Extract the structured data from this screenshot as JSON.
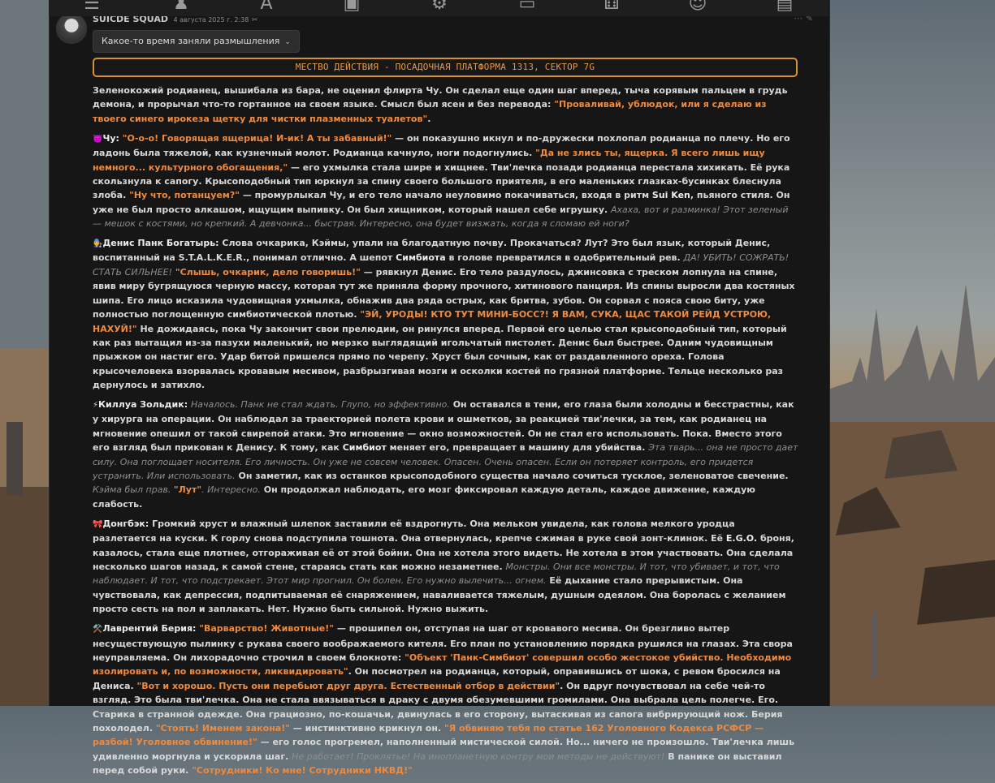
{
  "post": {
    "author": "SUICDE SQUAD",
    "date": "4 августа 2025 г. 2:38",
    "date_mark": "✂",
    "reflection_button": "Какое-то время заняли размышления",
    "location": "МЕСТВО ДЕЙСТВИЯ - ПОСАДОЧНАЯ ПЛАТФОРМА 1313, СЕКТОР 7G"
  },
  "toolbar": {
    "icons": [
      "sliders-icon",
      "brush-icon",
      "text-icon",
      "book-icon",
      "user-gear-icon",
      "image-icon",
      "dice-icon",
      "smile-icon",
      "id-card-icon"
    ]
  },
  "p1": [
    "Зеленокожий родианец, вышибала из бара, не оценил флирта Чу. Он сделал еще один шаг вперед, тыча корявым пальцем в грудь демона, и прорычал что-то гортанное на своем языке. Смысл был ясен и без перевода: ",
    "\"Проваливай, ублюдок, или я сделаю из твоего синего ирокеза щетку для чистки плазменных туалетов\"",
    "."
  ],
  "p2": {
    "emoji": "👿",
    "name": "Чу:",
    "parts": [
      "\"О-о-о! Говорящая ящерица! И-ик! А ты забавный!\"",
      " — он показушно икнул и по-дружески похлопал родианца по плечу. Но его ладонь была тяжелой, как кузнечный молот. Родианца качнуло, ноги подогнулись. ",
      "\"Да не злись ты, ящерка. Я всего лишь ищу немного... культурного обогащения,\"",
      " — его ухмылка стала шире и хищнее. Тви'лечка позади родианца перестала хихикать. Её рука скользнула к сапогу. Крысоподобный тип юркнул за спину своего большого приятеля, в его маленьких глазках-бусинках блеснула злоба. ",
      "\"Ну что, потанцуем?\"",
      " — промурлыкал Чу, и его тело начало неуловимо покачиваться, входя в ритм ",
      "Sui Ken",
      ", пьяного стиля. Он уже не был просто алкашом, ищущим выпивку. Он был хищником, который нашел себе игрушку. ",
      "Ахаха, вот и разминка! Этот зеленый — мешок с костями, но крепкий. А девчонка... быстрая. Интересно, она будет визжать, когда я сломаю ей ноги?"
    ]
  },
  "p3": {
    "emoji": "🧑‍🔧",
    "name": "Денис Панк Богатырь:",
    "parts": [
      " Слова очкарика, Кэймы, упали на благодатную почву. Прокачаться? Лут? Это был язык, который Денис, воспитанный на S.T.A.L.K.E.R., понимал отлично. А шепот ",
      "Симбиота",
      " в голове превратился в одобрительный рев. ",
      "ДА! УБИТЬ! СОЖРАТЬ! СТАТЬ СИЛЬНЕЕ!",
      " ",
      "\"Слышь, очкарик, дело говоришь!\"",
      " — рявкнул Денис. Его тело раздулось, джинсовка с треском лопнула на спине, явив миру бугрящуюся черную массу, которая тут же приняла форму прочного, хитинового панциря. Из спины выросли два костяных шипа. Его лицо исказила чудовищная ухмылка, обнажив два ряда острых, как бритва, зубов. Он сорвал с пояса свою биту, уже полностью поглощенную симбиотической плотью. ",
      "\"ЭЙ, УРОДЫ! КТО ТУТ МИНИ-БОСС?! Я ВАМ, СУКА, ЩАС ТАКОЙ РЕЙД УСТРОЮ, НАХУЙ!\"",
      " Не дожидаясь, пока Чу закончит свои прелюдии, он ринулся вперед. Первой его целью стал крысоподобный тип, который как раз вытащил из-за пазухи маленький, но мерзко выглядящий игольчатый пистолет. Денис был быстрее. Одним чудовищным прыжком он настиг его. Удар битой пришелся прямо по черепу. Хруст был сочным, как от раздавленного ореха. Голова крысочеловека взорвалась кровавым месивом, разбрызгивая мозги и осколки костей по грязной платформе. Тельце несколько раз дернулось и затихло."
    ]
  },
  "p4": {
    "emoji": "⚡",
    "name": "Киллуа Зольдик:",
    "parts": [
      " ",
      "Началось. Панк не стал ждать. Глупо, но эффективно.",
      " Он оставался в тени, его глаза были холодны и бесстрастны, как у хирурга на операции. Он наблюдал за траекторией полета крови и ошметков, за реакцией тви'лечки, за тем, как родианец на мгновение опешил от такой свирепой атаки. Это мгновение — окно возможностей. Он не стал его использовать. Пока. Вместо этого его взгляд был прикован к Денису. К тому, как ",
      "Симбиот",
      " меняет его, превращает в машину для убийства. ",
      "Эта тварь... она не просто дает силу. Она поглощает носителя. Его личность. Он уже не совсем человек. Опасен. Очень опасен. Если он потеряет контроль, его придется устранить. Или использовать.",
      " Он заметил, как из останков крысоподобного существа начало сочиться тусклое, зеленоватое свечение. ",
      "Кэйма был прав. ",
      "\"Лут\"",
      ". Интересно.",
      " Он продолжал наблюдать, его мозг фиксировал каждую деталь, каждое движение, каждую слабость."
    ]
  },
  "p5": {
    "emoji": "🎀",
    "name": "Донгбэк:",
    "parts": [
      " Громкий хруст и влажный шлепок заставили её вздрогнуть. Она мельком увидела, как голова мелкого уродца разлетается на куски. К горлу снова подступила тошнота. Она отвернулась, крепче сжимая в руке свой зонт-клинок. Её ",
      "E.G.O.",
      " броня, казалось, стала еще плотнее, отгораживая её от этой бойни. Она не хотела этого видеть. Не хотела в этом участвовать. Она сделала несколько шагов назад, к самой стене, стараясь стать как можно незаметнее. ",
      "Монстры. Они все монстры. И тот, что убивает, и тот, что наблюдает. И тот, что подстрекает. Этот мир прогнил. Он болен. Его нужно вылечить... огнем.",
      " Её дыхание стало прерывистым. Она чувствовала, как депрессия, подпитываемая её снаряжением, наваливается тяжелым, душным одеялом. Она боролась с желанием просто сесть на пол и заплакать. Нет. Нужно быть сильной. Нужно выжить."
    ]
  },
  "p6": {
    "emoji": "⚒️",
    "name": "Лаврентий Берия:",
    "parts": [
      " ",
      "\"Варварство! Животные!\"",
      " — прошипел он, отступая на шаг от кровавого месива. Он брезгливо вытер несуществующую пылинку с рукава своего воображаемого кителя. Его план по установлению порядка рушился на глазах. Эта свора неуправляема. Он лихорадочно строчил в своем блокноте: ",
      "\"Объект 'Панк-Симбиот' совершил особо жестокое убийство. Необходимо изолировать и, по возможности, ликвидировать\"",
      ". Он посмотрел на родианца, который, оправившись от шока, с ревом бросился на Дениса. ",
      "\"Вот и хорошо. Пусть они перебьют друг друга. Естественный отбор в действии\"",
      ". Он вдруг почувствовал на себе чей-то взгляд. Это была тви'лечка. Она не стала ввязываться в драку с двумя обезумевшими громилами. Она выбрала цель полегче. Его. Старика в странной одежде. Она грациозно, по-кошачьи, двинулась в его сторону, вытаскивая из сапога вибрирующий нож. Берия похолодел. ",
      "\"Стоять! Именем закона!\"",
      " — инстинктивно крикнул он. ",
      "\"Я обвиняю тебя по статье 162 Уголовного Кодекса РСФСР — разбой! Уголовное обвинение!\"",
      " — его голос прогремел, наполненный мистической силой. Но... ничего не произошло. Тви'лечка лишь удивленно моргнула и ускорила шаг. ",
      "Не работает! Проклятье! На инопланетную контру мои методы не действуют!",
      " В панике он выставил перед собой руки. ",
      "\"Сотрудники! Ко мне! Сотрудники НКВД!\""
    ]
  }
}
